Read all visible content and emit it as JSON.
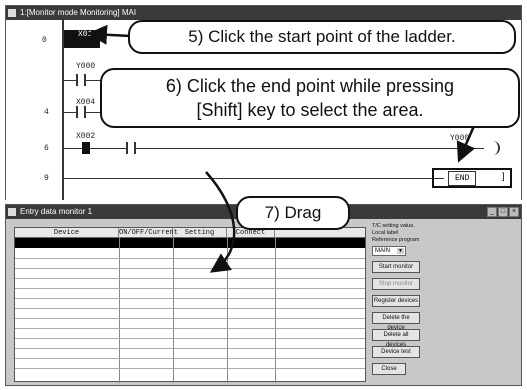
{
  "ladder_window": {
    "title": "1:[Monitor mode Monitoring]    MAI",
    "rungs": [
      {
        "number": "0",
        "device": "X010"
      },
      {
        "number": "",
        "device": "Y000"
      },
      {
        "number": "4",
        "device": "X004"
      },
      {
        "number": "6",
        "device": "X002"
      },
      {
        "number": "9",
        "device": ""
      }
    ],
    "coil_label": "Y000",
    "end_label": "END"
  },
  "callouts": {
    "step5": "5) Click the start point of the ladder.",
    "step6_line1": "6) Click the end point while pressing",
    "step6_line2": "[Shift] key to select the area.",
    "step7": "7) Drag"
  },
  "monitor_window": {
    "title": "Entry data monitor 1",
    "columns": [
      "Device",
      "ON/OFF/Current",
      "Setting value",
      "Connect"
    ],
    "side_text_1": "T/C setting value,",
    "side_text_2": "Local label",
    "side_text_3": "Reference program",
    "program_select": "MAIN",
    "buttons": {
      "start_monitor": "Start monitor",
      "stop_monitor": "Stop monitor",
      "register": "Register devices",
      "delete": "Delete the device",
      "delete_all": "Delete all devices",
      "device_test": "Device test",
      "close": "Close"
    }
  }
}
